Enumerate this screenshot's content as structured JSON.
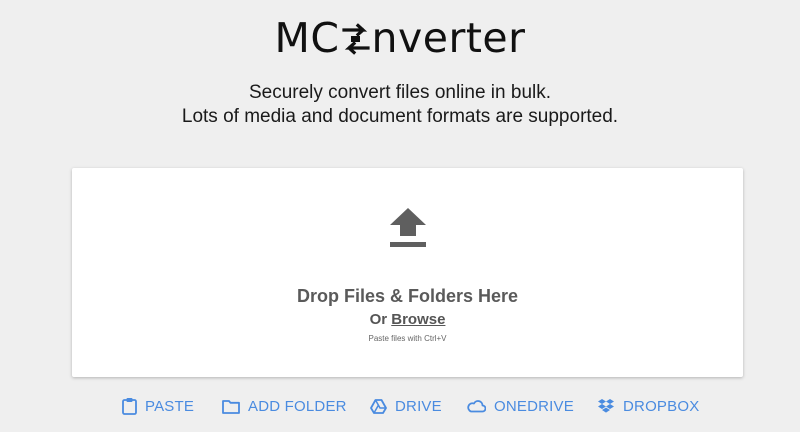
{
  "brand": {
    "logo_prefix": "MC",
    "logo_suffix": "nverter"
  },
  "tagline": {
    "line1": "Securely convert files online in bulk.",
    "line2": "Lots of media and document formats are supported."
  },
  "dropzone": {
    "icon": "upload-icon",
    "title": "Drop Files & Folders Here",
    "or_text": "Or ",
    "browse_label": "Browse",
    "paste_hint": "Paste files with Ctrl+V"
  },
  "sources": [
    {
      "label": "PASTE",
      "icon": "clipboard-icon"
    },
    {
      "label": "ADD FOLDER",
      "icon": "folder-icon"
    },
    {
      "label": "DRIVE",
      "icon": "google-drive-icon"
    },
    {
      "label": "ONEDRIVE",
      "icon": "onedrive-icon"
    },
    {
      "label": "DROPBOX",
      "icon": "dropbox-icon"
    }
  ],
  "colors": {
    "background": "#efefef",
    "accent": "#4a8be0",
    "icon_gray": "#5f5f5f"
  }
}
